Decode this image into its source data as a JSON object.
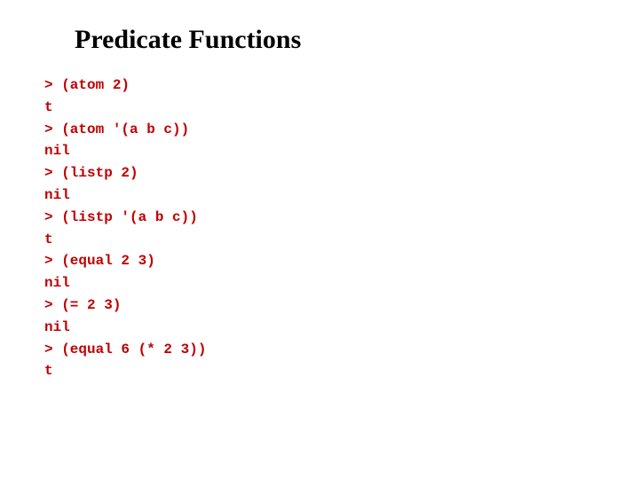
{
  "title": "Predicate Functions",
  "code": {
    "l1": "> (atom 2)",
    "l2": "t",
    "l3": "> (atom '(a b c))",
    "l4": "nil",
    "l5": "> (listp 2)",
    "l6": "nil",
    "l7": "> (listp '(a b c))",
    "l8": "t",
    "l9": "> (equal 2 3)",
    "l10": "nil",
    "l11": "> (= 2 3)",
    "l12": "nil",
    "l13": "> (equal 6 (* 2 3))",
    "l14": "t"
  }
}
